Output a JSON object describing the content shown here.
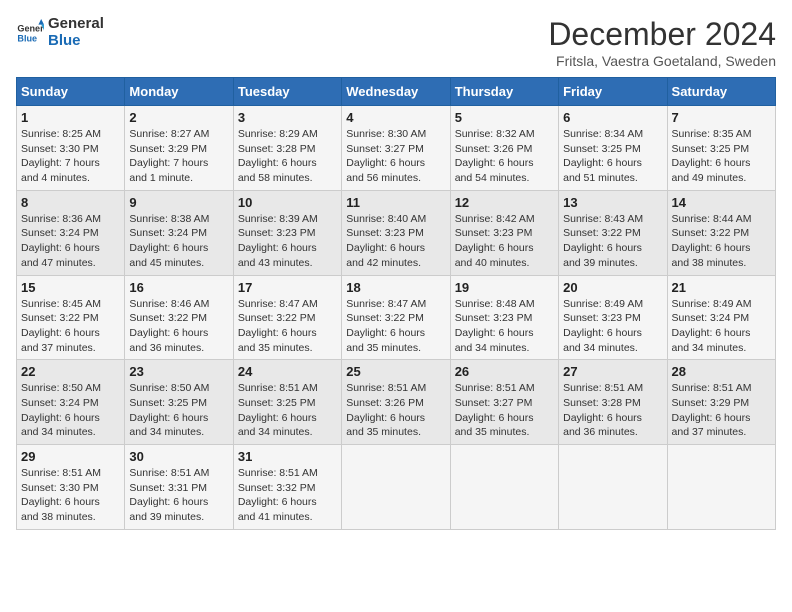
{
  "header": {
    "logo_line1": "General",
    "logo_line2": "Blue",
    "title": "December 2024",
    "subtitle": "Fritsla, Vaestra Goetaland, Sweden"
  },
  "weekdays": [
    "Sunday",
    "Monday",
    "Tuesday",
    "Wednesday",
    "Thursday",
    "Friday",
    "Saturday"
  ],
  "weeks": [
    [
      {
        "day": "1",
        "info": "Sunrise: 8:25 AM\nSunset: 3:30 PM\nDaylight: 7 hours\nand 4 minutes."
      },
      {
        "day": "2",
        "info": "Sunrise: 8:27 AM\nSunset: 3:29 PM\nDaylight: 7 hours\nand 1 minute."
      },
      {
        "day": "3",
        "info": "Sunrise: 8:29 AM\nSunset: 3:28 PM\nDaylight: 6 hours\nand 58 minutes."
      },
      {
        "day": "4",
        "info": "Sunrise: 8:30 AM\nSunset: 3:27 PM\nDaylight: 6 hours\nand 56 minutes."
      },
      {
        "day": "5",
        "info": "Sunrise: 8:32 AM\nSunset: 3:26 PM\nDaylight: 6 hours\nand 54 minutes."
      },
      {
        "day": "6",
        "info": "Sunrise: 8:34 AM\nSunset: 3:25 PM\nDaylight: 6 hours\nand 51 minutes."
      },
      {
        "day": "7",
        "info": "Sunrise: 8:35 AM\nSunset: 3:25 PM\nDaylight: 6 hours\nand 49 minutes."
      }
    ],
    [
      {
        "day": "8",
        "info": "Sunrise: 8:36 AM\nSunset: 3:24 PM\nDaylight: 6 hours\nand 47 minutes."
      },
      {
        "day": "9",
        "info": "Sunrise: 8:38 AM\nSunset: 3:24 PM\nDaylight: 6 hours\nand 45 minutes."
      },
      {
        "day": "10",
        "info": "Sunrise: 8:39 AM\nSunset: 3:23 PM\nDaylight: 6 hours\nand 43 minutes."
      },
      {
        "day": "11",
        "info": "Sunrise: 8:40 AM\nSunset: 3:23 PM\nDaylight: 6 hours\nand 42 minutes."
      },
      {
        "day": "12",
        "info": "Sunrise: 8:42 AM\nSunset: 3:23 PM\nDaylight: 6 hours\nand 40 minutes."
      },
      {
        "day": "13",
        "info": "Sunrise: 8:43 AM\nSunset: 3:22 PM\nDaylight: 6 hours\nand 39 minutes."
      },
      {
        "day": "14",
        "info": "Sunrise: 8:44 AM\nSunset: 3:22 PM\nDaylight: 6 hours\nand 38 minutes."
      }
    ],
    [
      {
        "day": "15",
        "info": "Sunrise: 8:45 AM\nSunset: 3:22 PM\nDaylight: 6 hours\nand 37 minutes."
      },
      {
        "day": "16",
        "info": "Sunrise: 8:46 AM\nSunset: 3:22 PM\nDaylight: 6 hours\nand 36 minutes."
      },
      {
        "day": "17",
        "info": "Sunrise: 8:47 AM\nSunset: 3:22 PM\nDaylight: 6 hours\nand 35 minutes."
      },
      {
        "day": "18",
        "info": "Sunrise: 8:47 AM\nSunset: 3:22 PM\nDaylight: 6 hours\nand 35 minutes."
      },
      {
        "day": "19",
        "info": "Sunrise: 8:48 AM\nSunset: 3:23 PM\nDaylight: 6 hours\nand 34 minutes."
      },
      {
        "day": "20",
        "info": "Sunrise: 8:49 AM\nSunset: 3:23 PM\nDaylight: 6 hours\nand 34 minutes."
      },
      {
        "day": "21",
        "info": "Sunrise: 8:49 AM\nSunset: 3:24 PM\nDaylight: 6 hours\nand 34 minutes."
      }
    ],
    [
      {
        "day": "22",
        "info": "Sunrise: 8:50 AM\nSunset: 3:24 PM\nDaylight: 6 hours\nand 34 minutes."
      },
      {
        "day": "23",
        "info": "Sunrise: 8:50 AM\nSunset: 3:25 PM\nDaylight: 6 hours\nand 34 minutes."
      },
      {
        "day": "24",
        "info": "Sunrise: 8:51 AM\nSunset: 3:25 PM\nDaylight: 6 hours\nand 34 minutes."
      },
      {
        "day": "25",
        "info": "Sunrise: 8:51 AM\nSunset: 3:26 PM\nDaylight: 6 hours\nand 35 minutes."
      },
      {
        "day": "26",
        "info": "Sunrise: 8:51 AM\nSunset: 3:27 PM\nDaylight: 6 hours\nand 35 minutes."
      },
      {
        "day": "27",
        "info": "Sunrise: 8:51 AM\nSunset: 3:28 PM\nDaylight: 6 hours\nand 36 minutes."
      },
      {
        "day": "28",
        "info": "Sunrise: 8:51 AM\nSunset: 3:29 PM\nDaylight: 6 hours\nand 37 minutes."
      }
    ],
    [
      {
        "day": "29",
        "info": "Sunrise: 8:51 AM\nSunset: 3:30 PM\nDaylight: 6 hours\nand 38 minutes."
      },
      {
        "day": "30",
        "info": "Sunrise: 8:51 AM\nSunset: 3:31 PM\nDaylight: 6 hours\nand 39 minutes."
      },
      {
        "day": "31",
        "info": "Sunrise: 8:51 AM\nSunset: 3:32 PM\nDaylight: 6 hours\nand 41 minutes."
      },
      {
        "day": "",
        "info": ""
      },
      {
        "day": "",
        "info": ""
      },
      {
        "day": "",
        "info": ""
      },
      {
        "day": "",
        "info": ""
      }
    ]
  ]
}
